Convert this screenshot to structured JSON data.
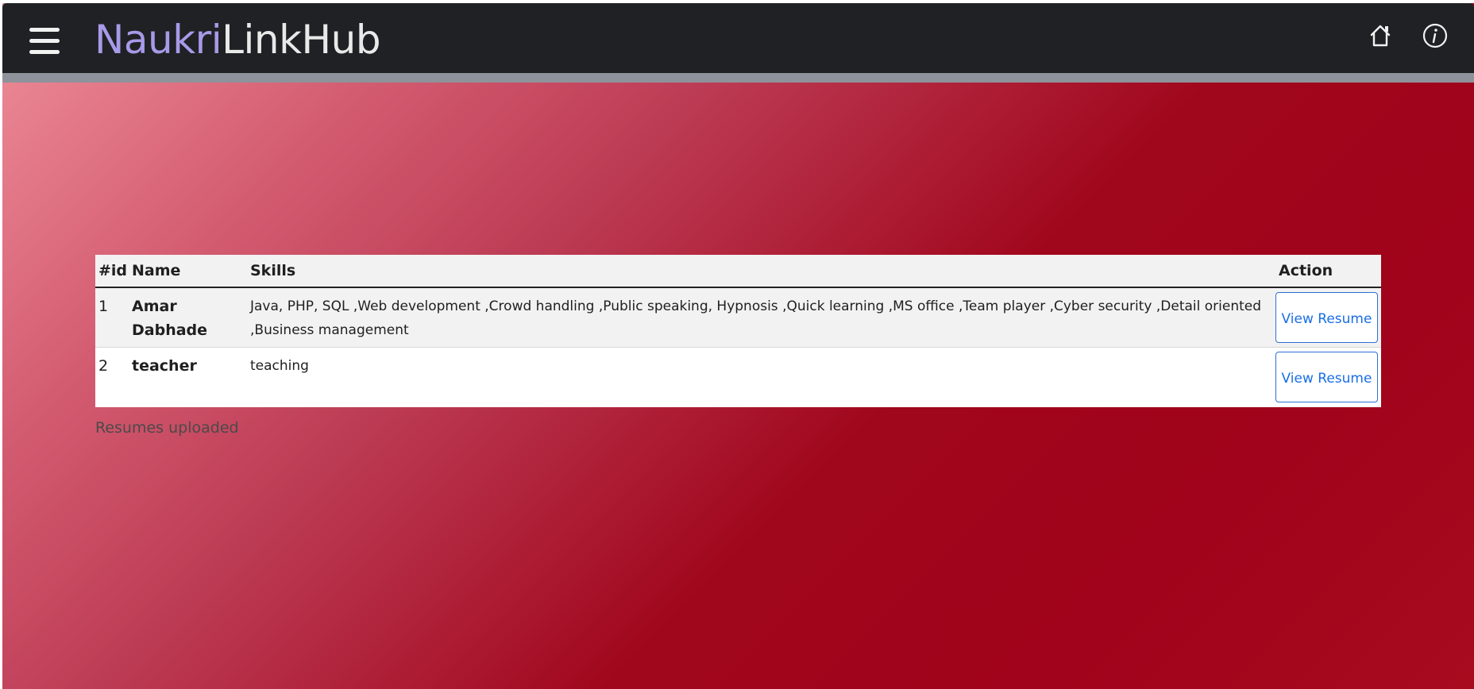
{
  "navbar": {
    "brand_part1": "Naukri",
    "brand_part2": "LinkHub",
    "icons": [
      "menu-icon",
      "home-icon",
      "info-icon"
    ]
  },
  "table": {
    "headers": {
      "id": "#id",
      "name": "Name",
      "skills": "Skills",
      "action": "Action"
    },
    "rows": [
      {
        "id": "1",
        "name": "Amar Dabhade",
        "skills": "Java, PHP, SQL ,Web development ,Crowd handling ,Public speaking, Hypnosis ,Quick learning ,MS office ,Team player ,Cyber security ,Detail oriented ,Business management",
        "action_label": "View Resume"
      },
      {
        "id": "2",
        "name": "teacher",
        "skills": "teaching",
        "action_label": "View Resume"
      }
    ]
  },
  "caption": "Resumes uploaded",
  "colors": {
    "navbar_bg": "#202124",
    "brand_accent": "#a89ae8",
    "button_blue": "#1a6ee6",
    "background_red": "#a0061c"
  }
}
